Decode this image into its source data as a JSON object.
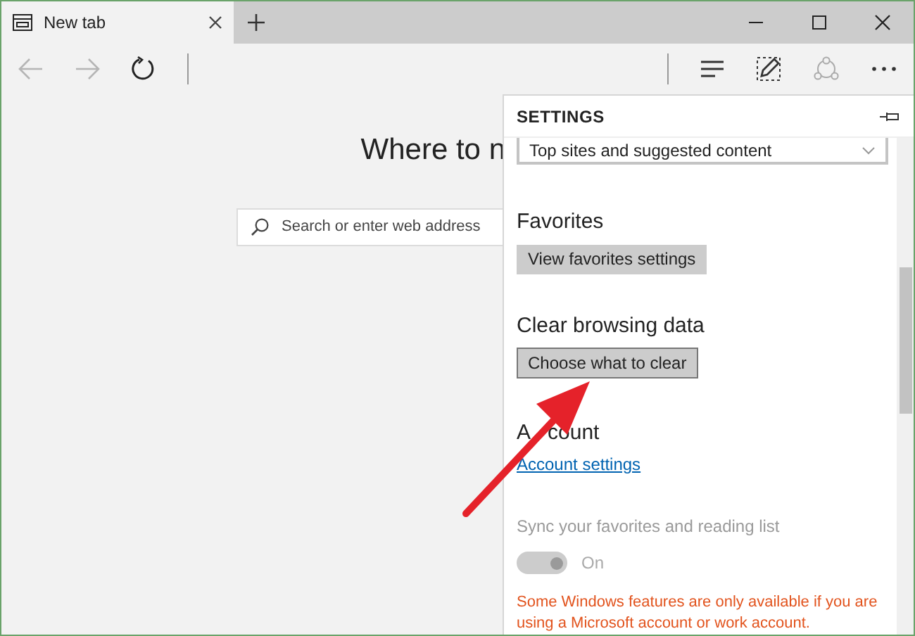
{
  "tabs": [
    {
      "title": "New tab",
      "selected": true
    }
  ],
  "toolbar": {
    "back_disabled": true,
    "forward_disabled": true
  },
  "new_tab_page": {
    "heading": "Where to n",
    "search": {
      "placeholder": "Search or enter web address"
    }
  },
  "settings": {
    "title": "SETTINGS",
    "dropdown": {
      "value": "Top sites and suggested content"
    },
    "sections": [
      {
        "kind": "button",
        "heading": "Favorites",
        "button": "View favorites settings",
        "outlined": false
      },
      {
        "kind": "button",
        "heading": "Clear browsing data",
        "button": "Choose what to clear",
        "outlined": true
      },
      {
        "kind": "account",
        "heading": "A",
        "heading_rest": "count",
        "link": "Account settings",
        "sync_label": "Sync your favorites and reading list",
        "toggle": {
          "on": true,
          "disabled": true,
          "label": "On"
        },
        "warning": "Some Windows features are only available if you are using a Microsoft account or work account."
      }
    ]
  }
}
